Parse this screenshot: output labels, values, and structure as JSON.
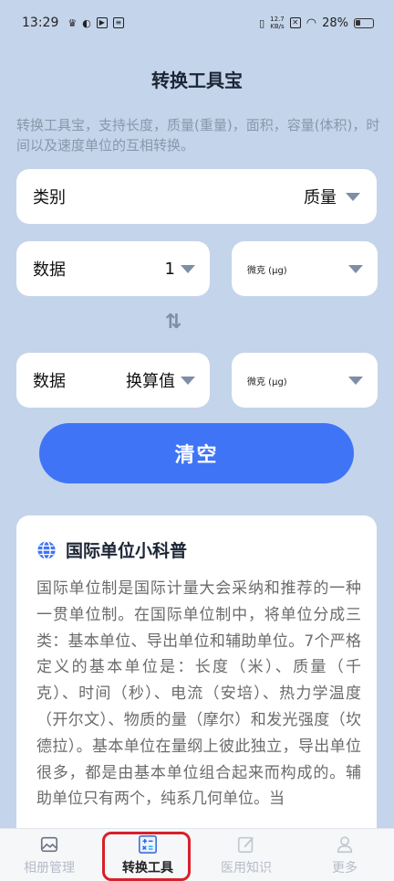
{
  "status": {
    "time": "13:29",
    "net_speed_top": "12.7",
    "net_speed_bottom": "KB/s",
    "battery": "28%"
  },
  "header": {
    "title": "转换工具宝"
  },
  "description": "转换工具宝，支持长度，质量(重量)，面积，容量(体积)，时间以及速度单位的互相转换。",
  "category": {
    "label": "类别",
    "value": "质量"
  },
  "input_row": {
    "label": "数据",
    "value": "1",
    "unit": "微克 (μg)"
  },
  "output_row": {
    "label": "数据",
    "value": "换算值",
    "unit": "微克 (μg)"
  },
  "clear_button": "清空",
  "info": {
    "title": "国际单位小科普",
    "body": "国际单位制是国际计量大会采纳和推荐的一种一贯单位制。在国际单位制中，将单位分成三类：基本单位、导出单位和辅助单位。7个严格定义的基本单位是：长度（米）、质量（千克）、时间（秒）、电流（安培）、热力学温度（开尔文）、物质的量（摩尔）和发光强度（坎德拉）。基本单位在量纲上彼此独立，导出单位很多，都是由基本单位组合起来而构成的。辅助单位只有两个，纯系几何单位。当"
  },
  "tabs": [
    {
      "label": "相册管理",
      "icon": "image-icon"
    },
    {
      "label": "转换工具",
      "icon": "calculator-icon"
    },
    {
      "label": "医用知识",
      "icon": "edit-icon"
    },
    {
      "label": "更多",
      "icon": "person-icon"
    }
  ],
  "colors": {
    "accent": "#3f74f6",
    "background": "#c4d4ea",
    "highlight": "#d8202a"
  }
}
